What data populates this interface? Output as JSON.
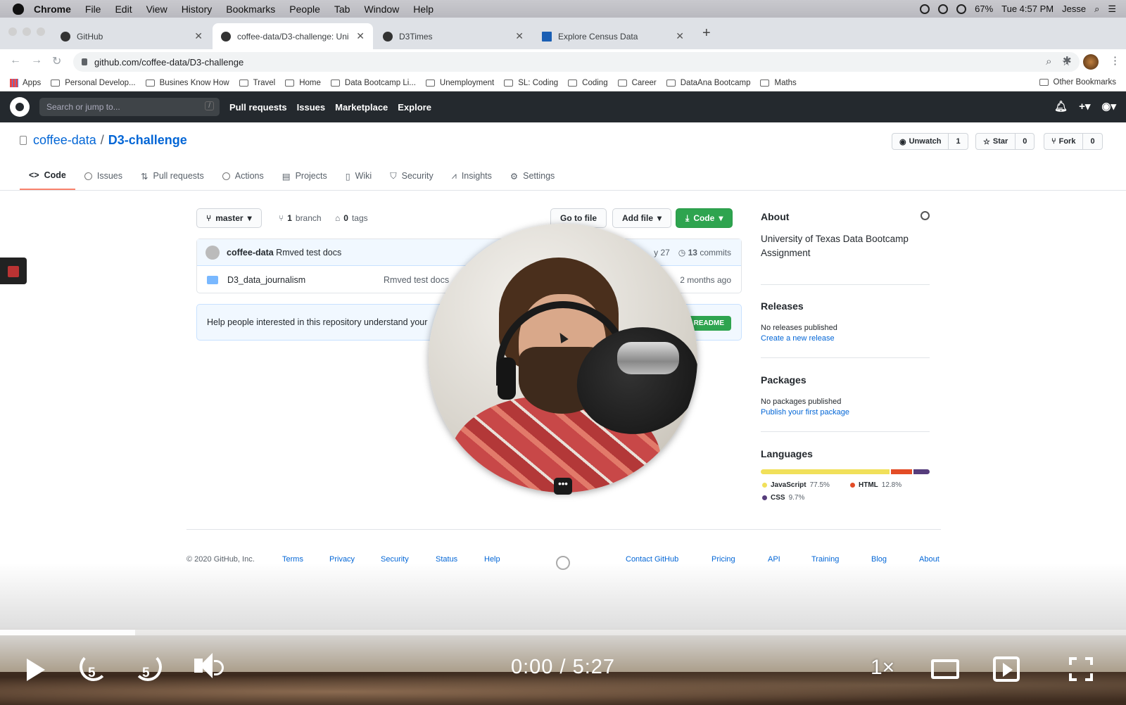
{
  "menubar": {
    "app": "Chrome",
    "items": [
      "File",
      "Edit",
      "View",
      "History",
      "Bookmarks",
      "People",
      "Tab",
      "Window",
      "Help"
    ],
    "battery": "67%",
    "clock": "Tue 4:57 PM",
    "user": "Jesse"
  },
  "tabs": [
    {
      "title": "GitHub"
    },
    {
      "title": "coffee-data/D3-challenge: Uni"
    },
    {
      "title": "D3Times"
    },
    {
      "title": "Explore Census Data"
    }
  ],
  "address": {
    "url": "github.com/coffee-data/D3-challenge"
  },
  "bookmarks": [
    "Apps",
    "Personal Develop...",
    "Busines Know How",
    "Travel",
    "Home",
    "Data Bootcamp Li...",
    "Unemployment",
    "SL: Coding",
    "Coding",
    "Career",
    "DataAna Bootcamp",
    "Maths"
  ],
  "other_bookmarks": "Other Bookmarks",
  "github": {
    "search_placeholder": "Search or jump to...",
    "search_key": "/",
    "nav": [
      "Pull requests",
      "Issues",
      "Marketplace",
      "Explore"
    ]
  },
  "repo": {
    "owner": "coffee-data",
    "sep": "/",
    "name": "D3-challenge",
    "unwatch": "Unwatch",
    "watch_count": "1",
    "star": "Star",
    "star_count": "0",
    "fork": "Fork",
    "fork_count": "0",
    "tabs": [
      "Code",
      "Issues",
      "Pull requests",
      "Actions",
      "Projects",
      "Wiki",
      "Security",
      "Insights",
      "Settings"
    ]
  },
  "branchbar": {
    "branch": "master",
    "branches_n": "1",
    "branches_label": "branch",
    "tags_n": "0",
    "tags_label": "tags",
    "goto": "Go to file",
    "addfile": "Add file",
    "code": "Code"
  },
  "commit": {
    "author": "coffee-data",
    "message": "Rmved test docs",
    "date_fragment": "y 27",
    "commits_n": "13",
    "commits_label": "commits"
  },
  "files": [
    {
      "name": "D3_data_journalism",
      "message": "Rmved test docs",
      "age": "2 months ago"
    }
  ],
  "readme": {
    "text": "Help people interested in this repository understand your",
    "button": "README"
  },
  "sidebar": {
    "about_title": "About",
    "about_desc": "University of Texas Data Bootcamp Assignment",
    "releases_title": "Releases",
    "releases_none": "No releases published",
    "releases_link": "Create a new release",
    "packages_title": "Packages",
    "packages_none": "No packages published",
    "packages_link": "Publish your first package",
    "languages_title": "Languages",
    "languages": [
      {
        "name": "JavaScript",
        "pct": "77.5%",
        "value": 77.5,
        "color": "#f1e05a"
      },
      {
        "name": "HTML",
        "pct": "12.8%",
        "value": 12.8,
        "color": "#e34c26"
      },
      {
        "name": "CSS",
        "pct": "9.7%",
        "value": 9.7,
        "color": "#563d7c"
      }
    ]
  },
  "footer": {
    "copyright": "© 2020 GitHub, Inc.",
    "left_links": [
      "Terms",
      "Privacy",
      "Security",
      "Status",
      "Help"
    ],
    "right_links": [
      "Contact GitHub",
      "Pricing",
      "API",
      "Training",
      "Blog",
      "About"
    ]
  },
  "video": {
    "current": "0:00",
    "sep": "/",
    "duration": "5:27",
    "progress": 0.12,
    "speed": "1×",
    "skip_back": "5",
    "skip_fwd": "5",
    "overlay_menu": "•••"
  }
}
